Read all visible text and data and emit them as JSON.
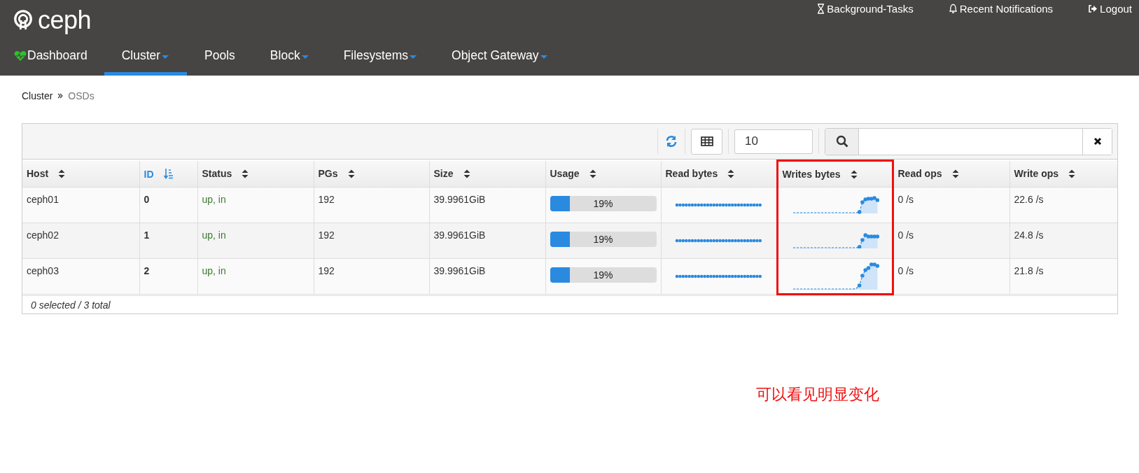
{
  "brand": "ceph",
  "top_links": [
    {
      "kind": "tasks",
      "label": "Background-Tasks"
    },
    {
      "kind": "notifications",
      "label": "Recent Notifications"
    },
    {
      "kind": "logout",
      "label": "Logout"
    }
  ],
  "nav": [
    {
      "label": "Dashboard",
      "kind": "dashboard",
      "dropdown": false,
      "selected": false
    },
    {
      "label": "Cluster",
      "kind": "plain",
      "dropdown": true,
      "selected": true
    },
    {
      "label": "Pools",
      "kind": "plain",
      "dropdown": false,
      "selected": false
    },
    {
      "label": "Block",
      "kind": "plain",
      "dropdown": true,
      "selected": false
    },
    {
      "label": "Filesystems",
      "kind": "plain",
      "dropdown": true,
      "selected": false
    },
    {
      "label": "Object Gateway",
      "kind": "plain",
      "dropdown": true,
      "selected": false
    }
  ],
  "breadcrumb": [
    "Cluster",
    "OSDs"
  ],
  "toolbar": {
    "page_size": "10"
  },
  "table": {
    "columns": [
      {
        "label": "Host",
        "sorted": false,
        "highlighted": false
      },
      {
        "label": "ID",
        "sorted": true,
        "highlighted": false
      },
      {
        "label": "Status",
        "sorted": false,
        "highlighted": false
      },
      {
        "label": "PGs",
        "sorted": false,
        "highlighted": false
      },
      {
        "label": "Size",
        "sorted": false,
        "highlighted": false
      },
      {
        "label": "Usage",
        "sorted": false,
        "highlighted": false
      },
      {
        "label": "Read bytes",
        "sorted": false,
        "highlighted": false
      },
      {
        "label": "Writes bytes",
        "sorted": false,
        "highlighted": true
      },
      {
        "label": "Read ops",
        "sorted": false,
        "highlighted": false
      },
      {
        "label": "Write ops",
        "sorted": false,
        "highlighted": false
      }
    ],
    "rows": [
      {
        "host": "ceph01",
        "id": "0",
        "status": "up, in",
        "pgs": "192",
        "size": "39.9961GiB",
        "usage": {
          "level": 0.19,
          "reading": "19%"
        },
        "read_ops": "0 /s",
        "write_ops": "22.6 /s"
      },
      {
        "host": "ceph02",
        "id": "1",
        "status": "up, in",
        "pgs": "192",
        "size": "39.9961GiB",
        "usage": {
          "level": 0.19,
          "reading": "19%"
        },
        "read_ops": "0 /s",
        "write_ops": "24.8 /s"
      },
      {
        "host": "ceph03",
        "id": "2",
        "status": "up, in",
        "pgs": "192",
        "size": "39.9961GiB",
        "usage": {
          "level": 0.19,
          "reading": "19%"
        },
        "read_ops": "0 /s",
        "write_ops": "21.8 /s"
      }
    ],
    "footer": "0 selected / 3 total"
  },
  "annotation": {
    "text": "可以看见明显变化"
  }
}
